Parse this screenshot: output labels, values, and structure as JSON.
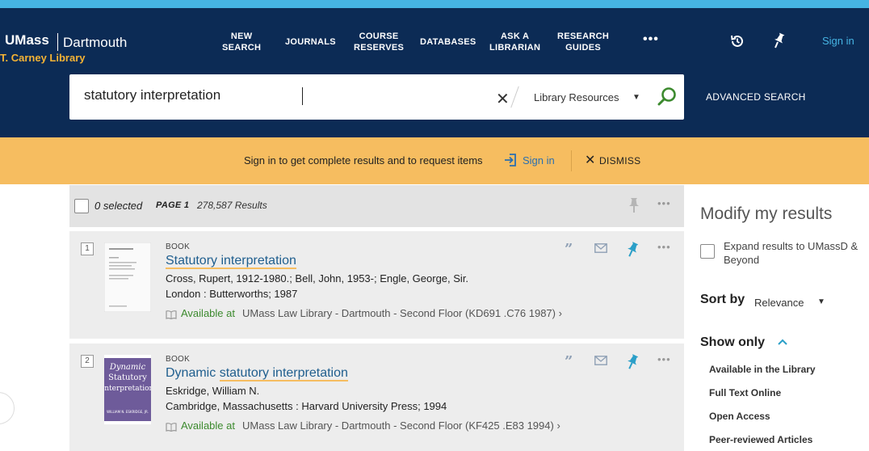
{
  "header": {
    "brand_umass": "UMass",
    "brand_dartmouth": "Dartmouth",
    "brand_library": "T. Carney Library",
    "nav": [
      {
        "label": "NEW\nSEARCH"
      },
      {
        "label": "JOURNALS"
      },
      {
        "label": "COURSE\nRESERVES"
      },
      {
        "label": "DATABASES"
      },
      {
        "label": "ASK A\nLIBRARIAN"
      },
      {
        "label": "RESEARCH\nGUIDES"
      }
    ],
    "more_label": "•••",
    "history_icon": "history-icon",
    "pin_icon": "pin-icon",
    "sign_in_label": "Sign in"
  },
  "search": {
    "value": "statutory interpretation",
    "scope": "Library Resources",
    "advanced_label": "ADVANCED SEARCH"
  },
  "banner": {
    "message": "Sign in to get complete results and to request items",
    "sign_in_label": "Sign in",
    "dismiss_label": "DISMISS"
  },
  "results_bar": {
    "selected": "0 selected",
    "page": "PAGE 1",
    "count": "278,587 Results"
  },
  "results": [
    {
      "num": "1",
      "type": "BOOK",
      "title_hl": "Statutory interpretation",
      "title_rest": "",
      "author": "Cross, Rupert, 1912-1980.; Bell, John, 1953-; Engle, George, Sir.",
      "pub": "London : Butterworths; 1987",
      "availability": "Available at",
      "location": "UMass Law Library - Dartmouth  - Second Floor (KD691 .C76 1987)  ›"
    },
    {
      "num": "2",
      "type": "BOOK",
      "title_pre": "Dynamic ",
      "title_hl": "statutory interpretation",
      "author": "Eskridge, William N.",
      "pub": "Cambridge, Massachusetts : Harvard University Press; 1994",
      "availability": "Available at",
      "location": "UMass Law Library - Dartmouth  - Second Floor (KF425 .E83 1994)  ›",
      "cover_text": [
        "Dynamic",
        "Statutory",
        "Interpretation",
        "WILLIAM N. ESKRIDGE, JR."
      ]
    }
  ],
  "sidebar": {
    "title": "Modify my results",
    "expand_label": "Expand results to UMassD & Beyond",
    "sort_label": "Sort by",
    "sort_value": "Relevance",
    "show_only_label": "Show only",
    "facets": [
      "Available in the Library",
      "Full Text Online",
      "Open Access",
      "Peer-reviewed Articles"
    ]
  },
  "colors": {
    "header_bg": "#0c2b55",
    "accent_blue": "#46b4e3",
    "banner_bg": "#f6bd60",
    "link": "#1f5e8e",
    "available": "#3c8a2e",
    "brand_gold": "#f5b335"
  }
}
